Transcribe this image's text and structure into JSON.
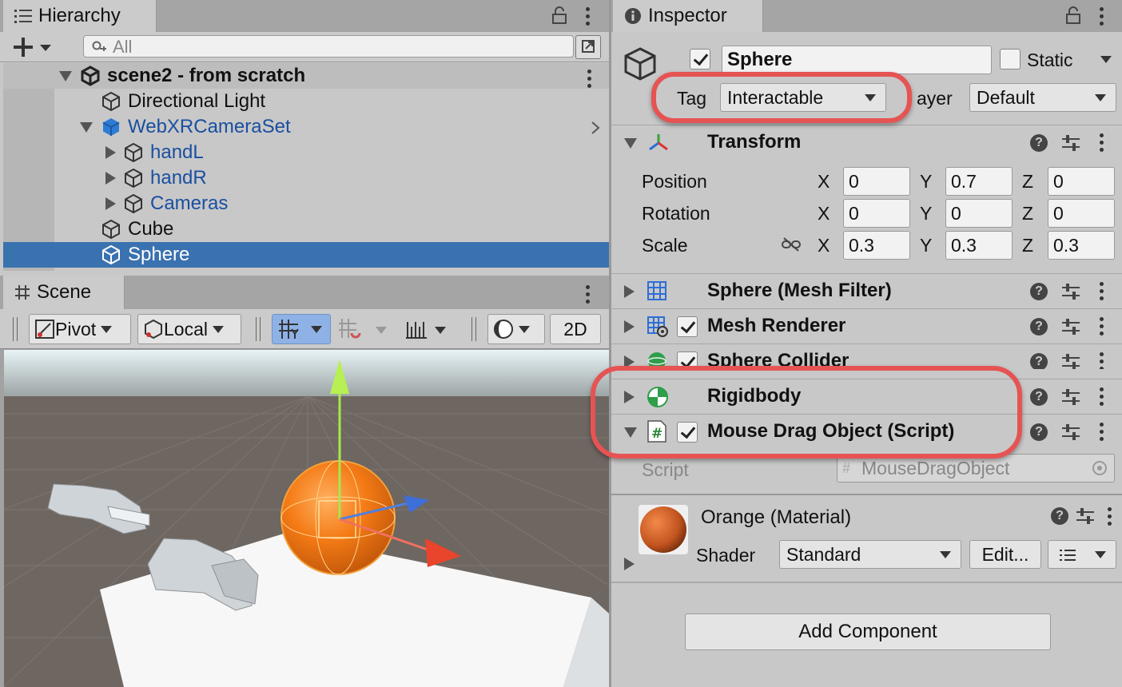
{
  "hierarchy": {
    "tab_label": "Hierarchy",
    "search_placeholder": "All",
    "scene_name": "scene2 - from scratch",
    "items": [
      {
        "label": "Directional Light"
      },
      {
        "label": "WebXRCameraSet"
      },
      {
        "label": "handL"
      },
      {
        "label": "handR"
      },
      {
        "label": "Cameras"
      },
      {
        "label": "Cube"
      },
      {
        "label": "Sphere"
      }
    ]
  },
  "scene": {
    "tab_label": "Scene",
    "pivot_label": "Pivot",
    "local_label": "Local",
    "mode_2d_label": "2D"
  },
  "inspector": {
    "tab_label": "Inspector",
    "object_name": "Sphere",
    "static_label": "Static",
    "tag_label": "Tag",
    "tag_value": "Interactable",
    "layer_label": "ayer",
    "layer_value": "Default",
    "transform": {
      "title": "Transform",
      "position_label": "Position",
      "rotation_label": "Rotation",
      "scale_label": "Scale",
      "axis_x": "X",
      "axis_y": "Y",
      "axis_z": "Z",
      "position": {
        "x": "0",
        "y": "0.7",
        "z": "0"
      },
      "rotation": {
        "x": "0",
        "y": "0",
        "z": "0"
      },
      "scale": {
        "x": "0.3",
        "y": "0.3",
        "z": "0.3"
      }
    },
    "components": {
      "mesh_filter": "Sphere (Mesh Filter)",
      "mesh_renderer": "Mesh Renderer",
      "sphere_collider": "Sphere Collider",
      "rigidbody": "Rigidbody",
      "mouse_drag": "Mouse Drag Object (Script)"
    },
    "script_label": "Script",
    "script_value": "MouseDragObject",
    "material_name": "Orange (Material)",
    "shader_label": "Shader",
    "shader_value": "Standard",
    "edit_label": "Edit...",
    "help_glyph": "?",
    "add_component_label": "Add Component"
  },
  "colors": {
    "selection": "#3a72b0",
    "highlight": "#e65353",
    "sphere": "#f07a1a",
    "panel": "#c8c8c8"
  },
  "icons": [
    "list-icon",
    "lock-icon",
    "kebab-icon",
    "plus-icon",
    "search-icon",
    "unity-scene-icon",
    "cube-icon",
    "info-icon",
    "transform-icon",
    "grid-icon",
    "rigidbody-icon",
    "script-icon",
    "link-icon",
    "target-icon"
  ]
}
